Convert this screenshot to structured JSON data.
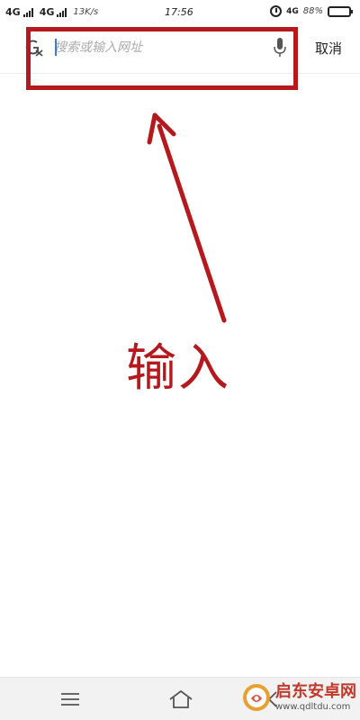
{
  "status_bar": {
    "network1": "4G",
    "network2": "4G",
    "speed": "13K/s",
    "time": "17:56",
    "network_small": "4G",
    "battery": "88%",
    "battery_level": 0.88
  },
  "search": {
    "placeholder": "搜索或输入网址",
    "value": "",
    "cancel_label": "取消"
  },
  "annotation": {
    "label": "输入",
    "color": "#b5191d"
  },
  "bottom_nav": {
    "icons": [
      "menu-icon",
      "home-icon",
      "back-icon"
    ]
  },
  "watermark": {
    "title": "启东安卓网",
    "url": "www.qdltdu.com"
  }
}
